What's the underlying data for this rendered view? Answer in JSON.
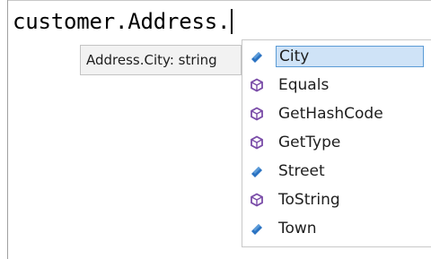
{
  "editor": {
    "code_text": "customer.Address."
  },
  "tooltip": {
    "text": "Address.City: string"
  },
  "completion_list": {
    "items": [
      {
        "label": "City",
        "kind": "property",
        "icon": "property-icon",
        "selected": true
      },
      {
        "label": "Equals",
        "kind": "method",
        "icon": "method-icon",
        "selected": false
      },
      {
        "label": "GetHashCode",
        "kind": "method",
        "icon": "method-icon",
        "selected": false
      },
      {
        "label": "GetType",
        "kind": "method",
        "icon": "method-icon",
        "selected": false
      },
      {
        "label": "Street",
        "kind": "property",
        "icon": "property-icon",
        "selected": false
      },
      {
        "label": "ToString",
        "kind": "method",
        "icon": "method-icon",
        "selected": false
      },
      {
        "label": "Town",
        "kind": "property",
        "icon": "property-icon",
        "selected": false
      }
    ]
  },
  "colors": {
    "selection_fill": "#cfe3f7",
    "selection_border": "#5b9bd5",
    "property_icon": "#2b73c2",
    "method_icon": "#7a4ca8"
  }
}
